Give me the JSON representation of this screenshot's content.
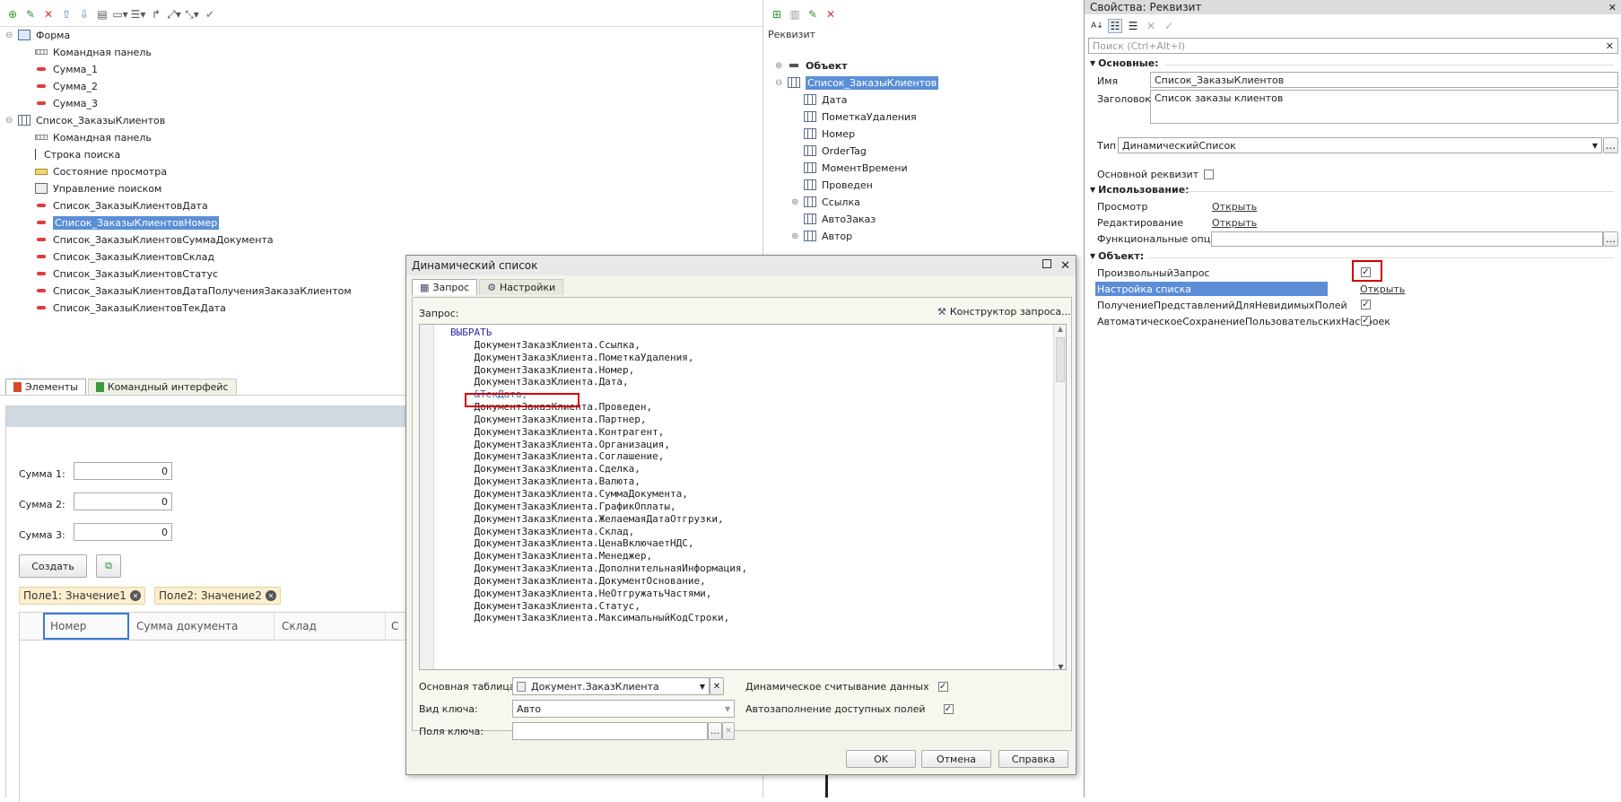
{
  "left_tree": {
    "items": [
      {
        "label": "Форма",
        "icon": "form-icon"
      },
      {
        "label": "Командная панель",
        "icon": "command-panel-icon"
      },
      {
        "label": "Сумма_1",
        "icon": "field-icon"
      },
      {
        "label": "Сумма_2",
        "icon": "field-icon"
      },
      {
        "label": "Сумма_3",
        "icon": "field-icon"
      },
      {
        "label": "Список_ЗаказыКлиентов",
        "icon": "table-icon"
      },
      {
        "label": "Командная панель",
        "icon": "command-panel-icon"
      },
      {
        "label": "Строка поиска",
        "icon": "search-string-icon"
      },
      {
        "label": "Состояние просмотра",
        "icon": "view-state-icon"
      },
      {
        "label": "Управление поиском",
        "icon": "search-control-icon"
      },
      {
        "label": "Список_ЗаказыКлиентовДата",
        "icon": "field-icon"
      },
      {
        "label": "Список_ЗаказыКлиентовНомер",
        "icon": "field-icon",
        "selected": true
      },
      {
        "label": "Список_ЗаказыКлиентовСуммаДокумента",
        "icon": "field-icon"
      },
      {
        "label": "Список_ЗаказыКлиентовСклад",
        "icon": "field-icon"
      },
      {
        "label": "Список_ЗаказыКлиентовСтатус",
        "icon": "field-icon"
      },
      {
        "label": "Список_ЗаказыКлиентовДатаПолученияЗаказаКлиентом",
        "icon": "field-icon"
      },
      {
        "label": "Список_ЗаказыКлиентовТекДата",
        "icon": "field-icon"
      }
    ],
    "tabs": [
      "Элементы",
      "Командный интерфейс"
    ]
  },
  "preview": {
    "sum1_label": "Сумма 1:",
    "sum1_value": "0",
    "sum2_label": "Сумма 2:",
    "sum2_value": "0",
    "sum3_label": "Сумма 3:",
    "sum3_value": "0",
    "create_label": "Создать",
    "filter1": "Поле1: Значение1",
    "filter2": "Поле2: Значение2",
    "columns": [
      "Номер",
      "Сумма документа",
      "Склад",
      "С"
    ]
  },
  "attr_panel": {
    "title": "Реквизит",
    "items": [
      {
        "label": "Объект",
        "bold": true,
        "expander": "+"
      },
      {
        "label": "Список_ЗаказыКлиентов",
        "selected": true,
        "expander": "−"
      },
      {
        "label": "Дата"
      },
      {
        "label": "ПометкаУдаления"
      },
      {
        "label": "Номер"
      },
      {
        "label": "OrderTag"
      },
      {
        "label": "МоментВремени"
      },
      {
        "label": "Проведен"
      },
      {
        "label": "Ссылка",
        "expander": "+"
      },
      {
        "label": "АвтоЗаказ"
      },
      {
        "label": "Автор",
        "expander": "+"
      }
    ]
  },
  "dialog": {
    "title": "Динамический список",
    "tabs": [
      "Запрос",
      "Настройки"
    ],
    "query_label": "Запрос:",
    "constructor_label": "Конструктор запроса...",
    "code_lines": [
      "ВЫБРАТЬ",
      "    ДокументЗаказКлиента.Ссылка,",
      "    ДокументЗаказКлиента.ПометкаУдаления,",
      "    ДокументЗаказКлиента.Номер,",
      "    ДокументЗаказКлиента.Дата,",
      "    &ТекДата,",
      "    ДокументЗаказКлиента.Проведен,",
      "    ДокументЗаказКлиента.Партнер,",
      "    ДокументЗаказКлиента.Контрагент,",
      "    ДокументЗаказКлиента.Организация,",
      "    ДокументЗаказКлиента.Соглашение,",
      "    ДокументЗаказКлиента.Сделка,",
      "    ДокументЗаказКлиента.Валюта,",
      "    ДокументЗаказКлиента.СуммаДокумента,",
      "    ДокументЗаказКлиента.ГрафикОплаты,",
      "    ДокументЗаказКлиента.ЖелаемаяДатаОтгрузки,",
      "    ДокументЗаказКлиента.Склад,",
      "    ДокументЗаказКлиента.ЦенаВключаетНДС,",
      "    ДокументЗаказКлиента.Менеджер,",
      "    ДокументЗаказКлиента.ДополнительнаяИнформация,",
      "    ДокументЗаказКлиента.ДокументОснование,",
      "    ДокументЗаказКлиента.НеОтгружатьЧастями,",
      "    ДокументЗаказКлиента.Статус,",
      "    ДокументЗаказКлиента.МаксимальныйКодСтроки,"
    ],
    "main_table_label": "Основная таблица:",
    "main_table_value": "Документ.ЗаказКлиента",
    "key_type_label": "Вид ключа:",
    "key_type_value": "Авто",
    "key_fields_label": "Поля ключа:",
    "key_fields_value": "",
    "dynamic_read_label": "Динамическое считывание данных",
    "dynamic_read_checked": true,
    "autofill_label": "Автозаполнение доступных полей",
    "autofill_checked": true,
    "ok_label": "OK",
    "cancel_label": "Отмена",
    "help_label": "Справка"
  },
  "props": {
    "title": "Свойства: Реквизит",
    "search_placeholder": "Поиск (Ctrl+Alt+I)",
    "sec_main": "Основные:",
    "name_label": "Имя",
    "name_value": "Список_ЗаказыКлиентов",
    "caption_label": "Заголовок",
    "caption_value": "Список заказы клиентов",
    "type_label": "Тип",
    "type_value": "ДинамическийСписок",
    "main_attr_label": "Основной реквизит",
    "main_attr_checked": false,
    "sec_usage": "Использование:",
    "view_label": "Просмотр",
    "view_link": "Открыть",
    "edit_label": "Редактирование",
    "edit_link": "Открыть",
    "func_opts_label": "Функциональные опции",
    "sec_object": "Объект:",
    "custom_query_label": "ПроизвольныйЗапрос",
    "custom_query_checked": true,
    "list_settings_label": "Настройка списка",
    "list_settings_link": "Открыть",
    "get_repr_label": "ПолучениеПредставленийДляНевидимыхПолей",
    "get_repr_checked": true,
    "autosave_label": "АвтоматическоеСохранениеПользовательскихНастроек",
    "autosave_checked": true
  },
  "colors": {
    "selection": "#5b8ed6",
    "highlight": "#d00000",
    "accent_green": "#eef3e6",
    "dialog_bg": "#f3f3ec"
  }
}
